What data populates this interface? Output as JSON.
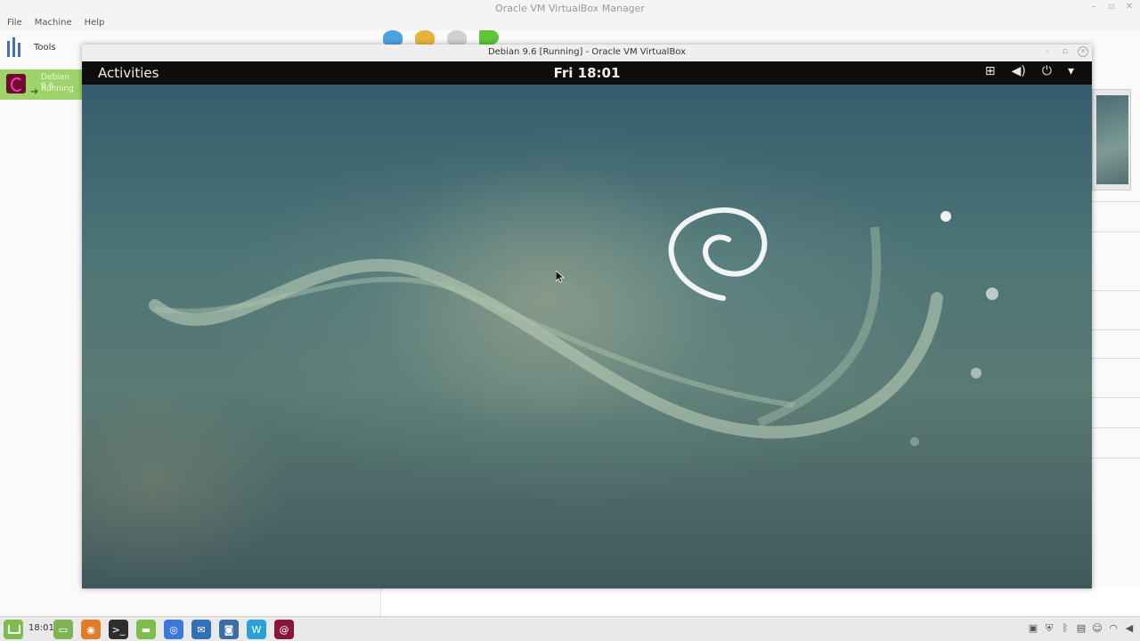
{
  "host": {
    "title": "Oracle VM VirtualBox Manager",
    "menu": [
      "File",
      "Machine",
      "Help"
    ],
    "sidebar": {
      "tools_label": "Tools",
      "vm": {
        "name": "Debian 9.6",
        "state": "Running",
        "icon": "debian-swirl-icon"
      }
    },
    "toolbar_icons": [
      "new-icon",
      "settings-icon",
      "discard-icon",
      "start-icon"
    ]
  },
  "guest": {
    "title": "Debian 9.6 [Running] - Oracle VM VirtualBox",
    "topbar": {
      "activities": "Activities",
      "clock": "Fri 18:01",
      "tray_icons": [
        "network-icon",
        "volume-icon",
        "power-icon",
        "dropdown-icon"
      ]
    }
  },
  "taskbar": {
    "time": "18:01",
    "apps": [
      {
        "name": "desktop-icon",
        "color": "#7fb353",
        "glyph": "▭"
      },
      {
        "name": "firefox-icon",
        "color": "#e07b26",
        "glyph": "◉"
      },
      {
        "name": "terminal-icon",
        "color": "#2e2e2e",
        "glyph": ">_"
      },
      {
        "name": "files-icon",
        "color": "#7cbd4d",
        "glyph": "▬"
      },
      {
        "name": "chrome-icon",
        "color": "#3b78d8",
        "glyph": "◎"
      },
      {
        "name": "mail-icon",
        "color": "#3470b6",
        "glyph": "✉"
      },
      {
        "name": "screenshot-icon",
        "color": "#3a6ea5",
        "glyph": "◙"
      },
      {
        "name": "vscode-icon",
        "color": "#2aa0d6",
        "glyph": "W"
      },
      {
        "name": "debian-icon",
        "color": "#8a1538",
        "glyph": "@"
      }
    ],
    "tray_icons": [
      "camera-icon",
      "shield-icon",
      "bluetooth-icon",
      "clipboard-icon",
      "user-icon",
      "wifi-icon",
      "volume-icon"
    ]
  }
}
